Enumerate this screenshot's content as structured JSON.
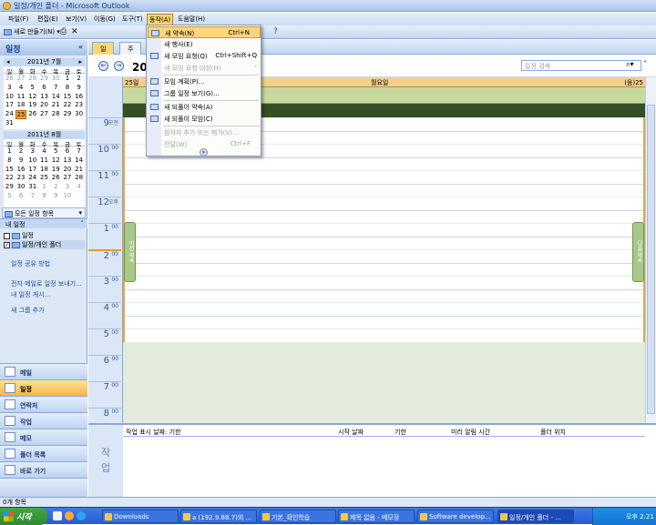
{
  "window": {
    "title": "일정/개인 폴더 - Microsoft Outlook"
  },
  "menubar": [
    "파일(F)",
    "편집(E)",
    "보기(V)",
    "이동(G)",
    "도구(T)",
    "동작(A)",
    "도움말(H)"
  ],
  "toolbar": {
    "new": "새로 만들기(N)"
  },
  "dropdown": {
    "items": [
      {
        "label": "새 약속(N)",
        "shortcut": "Ctrl+N",
        "state": "highlight"
      },
      {
        "label": "새 행사(E)",
        "shortcut": "",
        "state": "normal"
      },
      {
        "label": "새 모임 요청(Q)",
        "shortcut": "Ctrl+Shift+Q",
        "state": "normal"
      },
      {
        "label": "새 모임 요청 대상(H)",
        "shortcut": "",
        "state": "disabled"
      },
      {
        "label": "모임 계획(P)...",
        "shortcut": "",
        "state": "normal"
      },
      {
        "label": "그룹 일정 보기(G)...",
        "shortcut": "",
        "state": "normal"
      },
      {
        "label": "새 되풀이 약속(A)",
        "shortcut": "",
        "state": "normal"
      },
      {
        "label": "새 되풀이 모임(C)",
        "shortcut": "",
        "state": "normal"
      },
      {
        "label": "참석자 추가 또는 제거(V)...",
        "shortcut": "",
        "state": "disabled"
      },
      {
        "label": "전달(W)",
        "shortcut": "Ctrl+F",
        "state": "disabled"
      }
    ]
  },
  "nav": {
    "header": "일정",
    "mini_cal_1": {
      "title": "2011년 7월",
      "weekdays": [
        "일",
        "월",
        "화",
        "수",
        "목",
        "금",
        "토"
      ],
      "days": [
        "26",
        "27",
        "28",
        "29",
        "30",
        "1",
        "2",
        "3",
        "4",
        "5",
        "6",
        "7",
        "8",
        "9",
        "10",
        "11",
        "12",
        "13",
        "14",
        "15",
        "16",
        "17",
        "18",
        "19",
        "20",
        "21",
        "22",
        "23",
        "24",
        "25",
        "26",
        "27",
        "28",
        "29",
        "30",
        "31"
      ]
    },
    "mini_cal_2": {
      "title": "2011년 8월",
      "weekdays": [
        "일",
        "월",
        "화",
        "수",
        "목",
        "금",
        "토"
      ],
      "days": [
        "1",
        "2",
        "3",
        "4",
        "5",
        "6",
        "7",
        "8",
        "9",
        "10",
        "11",
        "12",
        "13",
        "14",
        "15",
        "16",
        "17",
        "18",
        "19",
        "20",
        "21",
        "22",
        "23",
        "24",
        "25",
        "26",
        "27",
        "28",
        "29",
        "30",
        "31",
        "1",
        "2",
        "3",
        "4",
        "5",
        "6",
        "7",
        "8",
        "9",
        "10"
      ]
    },
    "all_items": "모든 일정 항목",
    "my_calendars": "내 일정",
    "calendars": [
      "일정",
      "일정/개인 폴더"
    ],
    "links": [
      "일정 공유 방법",
      "전자 메일로 일정 보내기...",
      "내 일정 게시...",
      "새 그룹 추가"
    ],
    "panes": [
      "메일",
      "일정",
      "연락처",
      "작업",
      "메모",
      "폴더 목록",
      "바로 가기"
    ]
  },
  "main": {
    "tabs": [
      "일",
      "주"
    ],
    "date_label": "2011년 7월 25일",
    "search_placeholder": "일정 검색",
    "day_header_left": "25일",
    "day_header_center": "월요일",
    "day_header_right": "(음)25",
    "hours": [
      {
        "h": "9",
        "m": "오전"
      },
      {
        "h": "10",
        "m": "00"
      },
      {
        "h": "11",
        "m": "00"
      },
      {
        "h": "12",
        "m": "오후"
      },
      {
        "h": "1",
        "m": "00"
      },
      {
        "h": "2",
        "m": "00"
      },
      {
        "h": "3",
        "m": "00"
      },
      {
        "h": "4",
        "m": "00"
      },
      {
        "h": "5",
        "m": "00"
      },
      {
        "h": "6",
        "m": "00"
      },
      {
        "h": "7",
        "m": "00"
      },
      {
        "h": "8",
        "m": "00"
      }
    ],
    "prev_appt": "이전 약속",
    "next_appt": "다음 약속",
    "tasks_label": "작업",
    "task_columns": [
      "작업 표시 날짜: 기한",
      "시작 날짜",
      "기한",
      "미리 알림 시간",
      "폴더 위치"
    ]
  },
  "statusbar": "0개 항목",
  "taskbar": {
    "start": "시작",
    "items": [
      "Downloads",
      "a (192.9.88.7)의 ...",
      "기본_확인학습",
      "제목 없음 - 메모장",
      "Software develop...",
      "일정/개인 폴더 - ..."
    ],
    "clock": "오후 2:21"
  }
}
